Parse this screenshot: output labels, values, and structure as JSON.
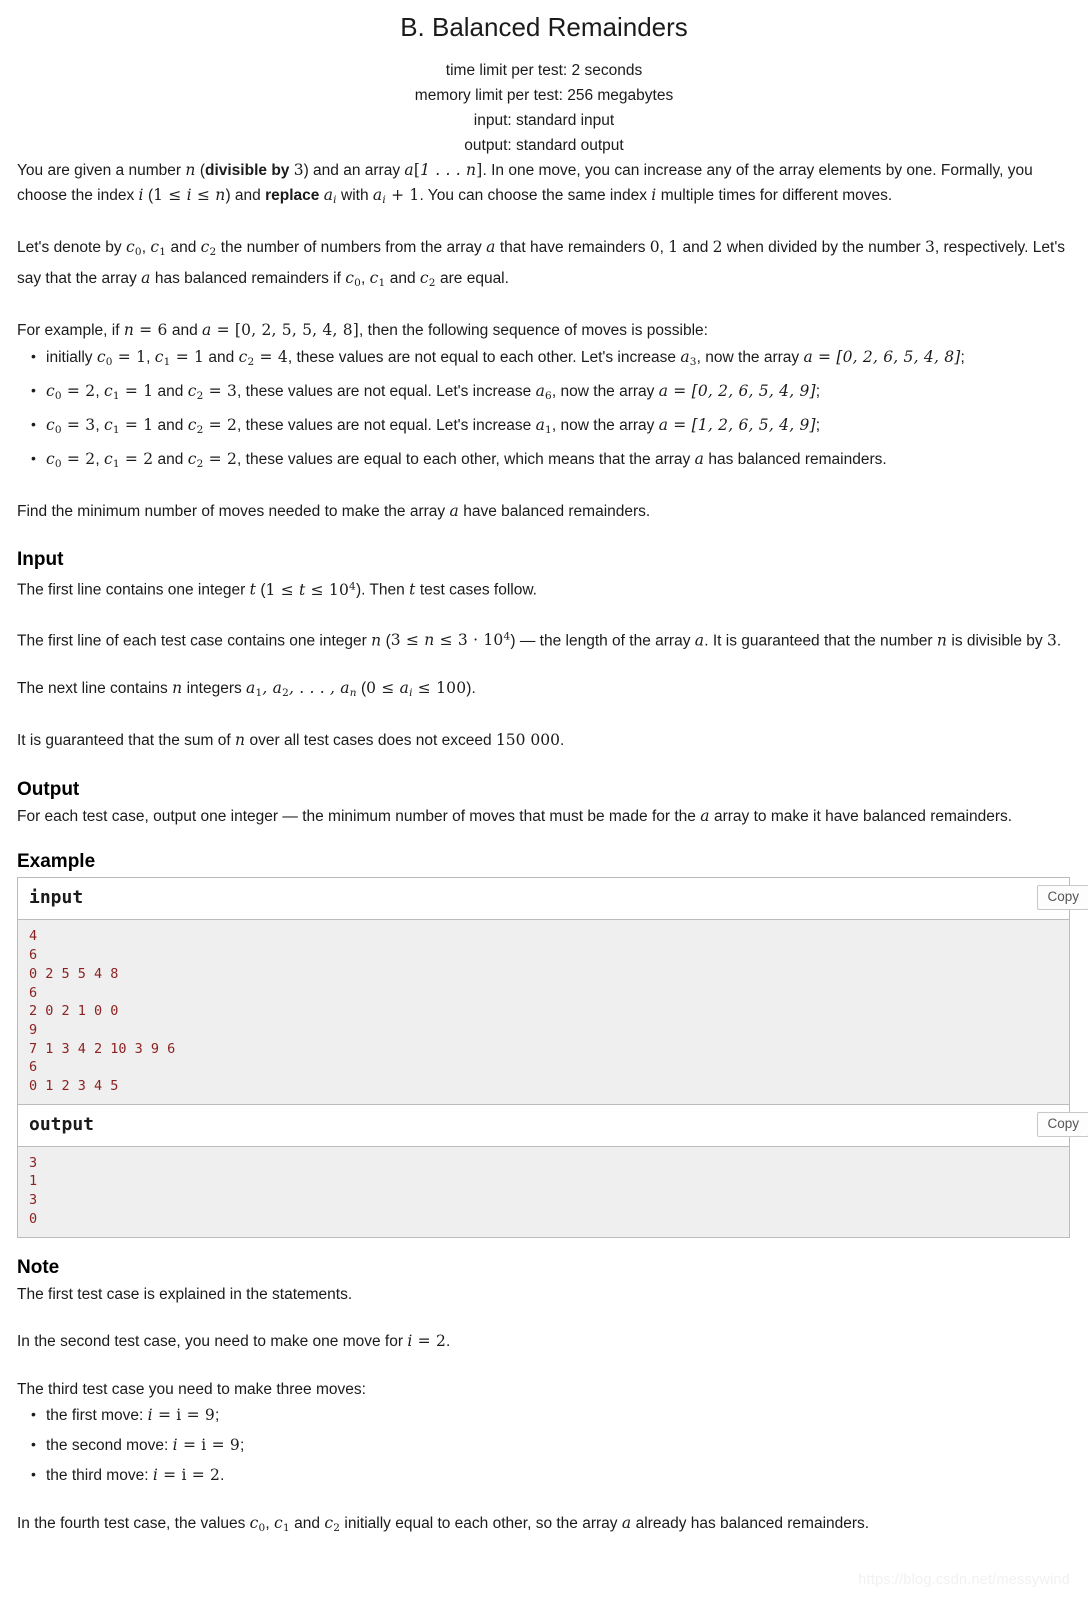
{
  "header": {
    "title": "B. Balanced Remainders",
    "time_limit": "time limit per test: 2 seconds",
    "memory_limit": "memory limit per test: 256 megabytes",
    "input_spec": "input: standard input",
    "output_spec": "output: standard output"
  },
  "statement": {
    "p1_a": "You are given a number ",
    "p1_n": "n",
    "p1_b": " (",
    "p1_divisible": "divisible by",
    "p1_three": "3",
    "p1_c": ") and an array ",
    "p1_array": "a[1 … n]",
    "p1_d": ". In one move, you can increase any of the array elements by one. Formally, you choose the index ",
    "p1_i": "i",
    "p1_e": " (",
    "p1_range": "1 ≤ i ≤ n",
    "p1_f": ") and ",
    "p1_replace": "replace",
    "p1_ai": "a",
    "p1_g": " with ",
    "p1_ai1": "a",
    "p1_plus1": "+ 1",
    "p1_h": ". You can choose the same index ",
    "p1_i2": "i",
    "p1_j": " multiple times for different moves.",
    "p2_a": "Let's denote by ",
    "p2_c0": "c",
    "p2_b": ", ",
    "p2_c1": "c",
    "p2_c": " and ",
    "p2_c2": "c",
    "p2_d": " the number of numbers from the array ",
    "p2_arr": "a",
    "p2_e": " that have remainders ",
    "p2_r0": "0",
    "p2_f": ", ",
    "p2_r1": "1",
    "p2_g": " and ",
    "p2_r2": "2",
    "p2_h": " when divided by the number ",
    "p2_r3": "3",
    "p2_i": ", respectively. Let's say that the array ",
    "p2_arr2": "a",
    "p2_j": " has balanced remainders if ",
    "p2_k": " are equal.",
    "p3_a": "For example, if ",
    "p3_n": "n = 6",
    "p3_b": " and ",
    "p3_a_eq": "a = [0, 2, 5, 5, 4, 8]",
    "p3_c": ", then the following sequence of moves is possible:",
    "p4": "Find the minimum number of moves needed to make the array a have balanced remainders."
  },
  "bullets_example": [
    {
      "prefix": "initially ",
      "c0": "1",
      "c1": "1",
      "c2": "4",
      "mid": ", these values are not equal to each other. Let's increase ",
      "a_index": "3",
      "mid2": ", now the array ",
      "array": "a = [0, 2, 6, 5, 4, 8]",
      "suffix": ";"
    },
    {
      "prefix": "",
      "c0": "2",
      "c1": "1",
      "c2": "3",
      "mid": ", these values are not equal. Let's increase ",
      "a_index": "6",
      "mid2": ", now the array ",
      "array": "a = [0, 2, 6, 5, 4, 9]",
      "suffix": ";"
    },
    {
      "prefix": "",
      "c0": "3",
      "c1": "1",
      "c2": "2",
      "mid": ", these values are not equal. Let's increase ",
      "a_index": "1",
      "mid2": ", now the array ",
      "array": "a = [1, 2, 6, 5, 4, 9]",
      "suffix": ";"
    },
    {
      "prefix": "",
      "c0": "2",
      "c1": "2",
      "c2": "2",
      "mid": ", these values are equal to each other, which means that the array ",
      "a_index": "",
      "mid2": " has balanced remainders.",
      "array": "",
      "suffix": ""
    }
  ],
  "input_section": {
    "heading": "Input",
    "p1_a": "The first line contains one integer ",
    "p1_t": "t",
    "p1_b": " (",
    "p1_range": "1 ≤ t ≤ 10",
    "p1_exp": "4",
    "p1_c": "). Then ",
    "p1_t2": "t",
    "p1_d": " test cases follow.",
    "p2_a": "The first line of each test case contains one integer ",
    "p2_n": "n",
    "p2_b": " (",
    "p2_range": "3 ≤ n ≤ 3 · 10",
    "p2_exp": "4",
    "p2_c": ") — the length of the array ",
    "p2_arr": "a",
    "p2_d": ". It is guaranteed that the number ",
    "p2_n2": "n",
    "p2_e": " is divisible by ",
    "p2_three": "3",
    "p2_f": ".",
    "p3_a": "The next line contains ",
    "p3_n": "n",
    "p3_b": " integers ",
    "p3_list": "a₁, a₂, …, aₙ",
    "p3_c": " (",
    "p3_range": "0 ≤ a",
    "p3_range2": "≤ 100",
    "p3_d": ").",
    "p4_a": "It is guaranteed that the sum of ",
    "p4_n": "n",
    "p4_b": " over all test cases does not exceed ",
    "p4_value": "150 000",
    "p4_c": "."
  },
  "output_section": {
    "heading": "Output",
    "p1_a": "For each test case, output one integer — the minimum number of moves that must be made for the ",
    "p1_arr": "a",
    "p1_b": " array to make it have balanced remainders."
  },
  "example": {
    "heading": "Example",
    "input_label": "input",
    "output_label": "output",
    "copy_label": "Copy",
    "input_data": "4\n6\n0 2 5 5 4 8\n6\n2 0 2 1 0 0\n9\n7 1 3 4 2 10 3 9 6\n6\n0 1 2 3 4 5",
    "output_data": "3\n1\n3\n0"
  },
  "note_section": {
    "heading": "Note",
    "p1": "The first test case is explained in the statements.",
    "p2_a": "In the second test case, you need to make one move for ",
    "p2_i": "i = 2",
    "p2_b": ".",
    "p3": "The third test case you need to make three moves:",
    "bullets": [
      {
        "label": "the first move: ",
        "value": "i = 9",
        "suffix": ";"
      },
      {
        "label": "the second move: ",
        "value": "i = 9",
        "suffix": ";"
      },
      {
        "label": "the third move: ",
        "value": "i = 2",
        "suffix": "."
      }
    ],
    "p4_a": "In the fourth test case, the values ",
    "p4_b": " initially equal to each other, so the array ",
    "p4_arr": "a",
    "p4_c": " already has balanced remainders."
  },
  "watermark": "https://blog.csdn.net/messywind",
  "colors": {
    "sample_text": "#8b2222",
    "sample_bg": "#efefef",
    "border": "#bbbbbb",
    "text": "#1b1b1b"
  }
}
